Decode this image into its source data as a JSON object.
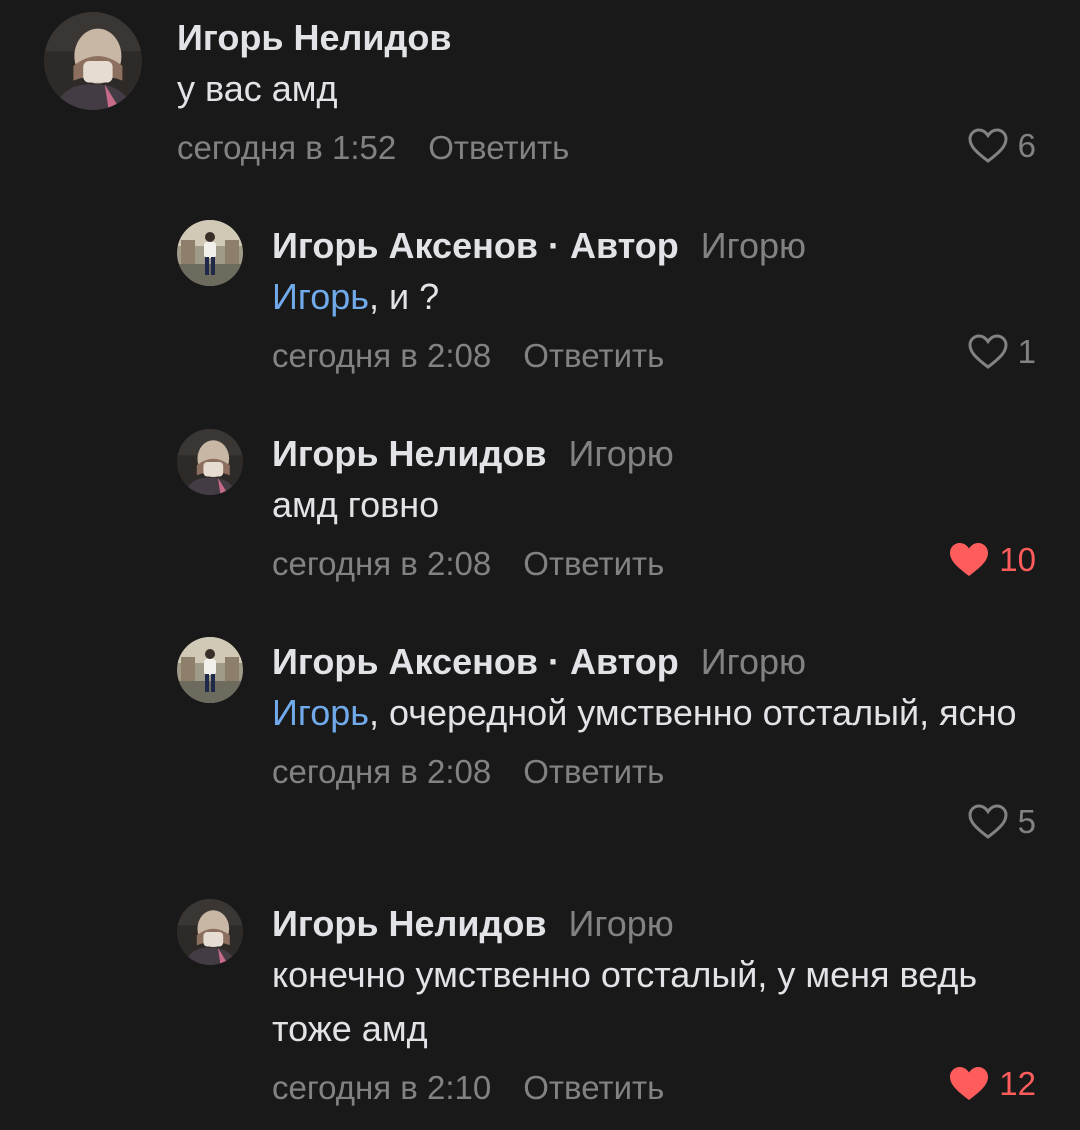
{
  "comments": [
    {
      "author": "Игорь Нелидов",
      "reply_to": "",
      "mention": "",
      "text": "у вас амд",
      "time": "сегодня в 1:52",
      "reply_label": "Ответить",
      "likes": "6",
      "liked": false
    },
    {
      "author": "Игорь Аксенов · Автор",
      "reply_to": "Игорю",
      "mention": "Игорь",
      "text": ", и ?",
      "time": "сегодня в 2:08",
      "reply_label": "Ответить",
      "likes": "1",
      "liked": false
    },
    {
      "author": "Игорь Нелидов",
      "reply_to": "Игорю",
      "mention": "",
      "text": "амд говно",
      "time": "сегодня в 2:08",
      "reply_label": "Ответить",
      "likes": "10",
      "liked": true
    },
    {
      "author": "Игорь Аксенов · Автор",
      "reply_to": "Игорю",
      "mention": "Игорь",
      "text": ", очередной умственно отсталый, ясно",
      "time": "сегодня в 2:08",
      "reply_label": "Ответить",
      "likes": "5",
      "liked": false
    },
    {
      "author": "Игорь Нелидов",
      "reply_to": "Игорю",
      "mention": "",
      "text": "конечно умственно отсталый, у меня ведь тоже амд",
      "time": "сегодня в 2:10",
      "reply_label": "Ответить",
      "likes": "12",
      "liked": true
    }
  ],
  "icons": {
    "like": "heart-outline-icon",
    "liked": "heart-filled-icon"
  },
  "colors": {
    "background": "#19191a",
    "text": "#e1e3e6",
    "secondary": "#828282",
    "mention": "#71aaeb",
    "liked": "#ff5c5c"
  }
}
